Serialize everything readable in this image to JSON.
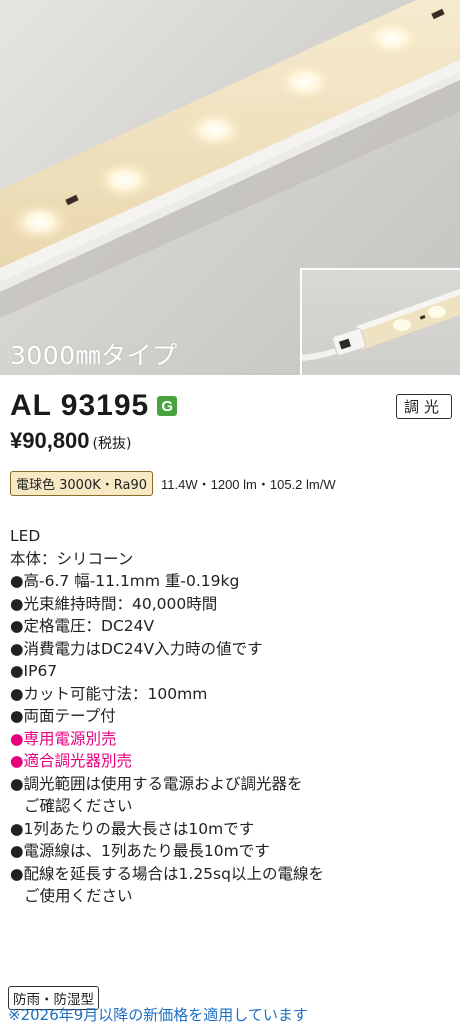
{
  "photo": {
    "caption": "3000㎜タイプ"
  },
  "product": {
    "model": "AL 93195",
    "g_badge": "G",
    "dimming_badge": "調光",
    "price": "¥90,800",
    "tax_note": "(税抜)",
    "color_badge": "電球色 3000K・Ra90",
    "spec": "11.4W・1200 lm・105.2 lm/W"
  },
  "details": [
    {
      "text": "LED",
      "style": "plain"
    },
    {
      "text": "本体：シリコーン",
      "style": "plain"
    },
    {
      "text": "●高-6.7 幅-11.1mm 重-0.19kg",
      "style": "plain"
    },
    {
      "text": "●光束維持時間：40,000時間",
      "style": "plain"
    },
    {
      "text": "●定格電圧：DC24V",
      "style": "plain"
    },
    {
      "text": "●消費電力はDC24V入力時の値です",
      "style": "plain"
    },
    {
      "text": "●IP67",
      "style": "plain"
    },
    {
      "text": "●カット可能寸法：100mm",
      "style": "plain"
    },
    {
      "text": "●両面テープ付",
      "style": "plain"
    },
    {
      "text": "●専用電源別売",
      "style": "pink"
    },
    {
      "text": "●適合調光器別売",
      "style": "pink"
    },
    {
      "text": "●調光範囲は使用する電源および調光器を",
      "style": "plain"
    },
    {
      "text": "ご確認ください",
      "style": "cont"
    },
    {
      "text": "●1列あたりの最大長さは10mです",
      "style": "plain"
    },
    {
      "text": "●電源線は、1列あたり最長10mです",
      "style": "plain"
    },
    {
      "text": "●配線を延長する場合は1.25sq以上の電線を",
      "style": "plain"
    },
    {
      "text": "ご使用ください",
      "style": "cont"
    }
  ],
  "footer": {
    "badge": "防雨・防湿型",
    "notice": "※2026年9月以降の新価格を適用しています"
  },
  "colors": {
    "pink": "#e6007e",
    "notice_blue": "#1e6fc2",
    "g_green": "#48a23f",
    "led_warm": "#fff6dc"
  }
}
